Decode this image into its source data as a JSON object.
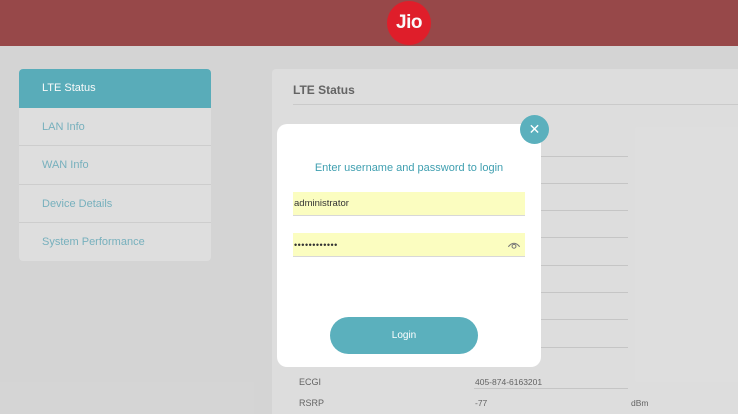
{
  "header": {
    "logo_text": "Jio"
  },
  "sidebar": {
    "items": [
      {
        "label": "LTE Status"
      },
      {
        "label": "LAN Info"
      },
      {
        "label": "WAN Info"
      },
      {
        "label": "Device Details"
      },
      {
        "label": "System Performance"
      }
    ]
  },
  "main": {
    "title": "LTE Status",
    "rows": [
      {
        "label": "ECGI",
        "value": "405-874-6163201",
        "unit": ""
      },
      {
        "label": "RSRP",
        "value": "-77",
        "unit": "dBm"
      }
    ]
  },
  "login_modal": {
    "title": "Enter username and password to login",
    "username_value": "administrator",
    "password_value": "••••••••••••",
    "login_label": "Login",
    "close_icon": "close-icon",
    "eye_icon": "eye-icon"
  },
  "colors": {
    "header": "#9b4a4b",
    "logo": "#e41f2b",
    "accent": "#5bb0bd",
    "input_bg": "#fbfdc0"
  }
}
